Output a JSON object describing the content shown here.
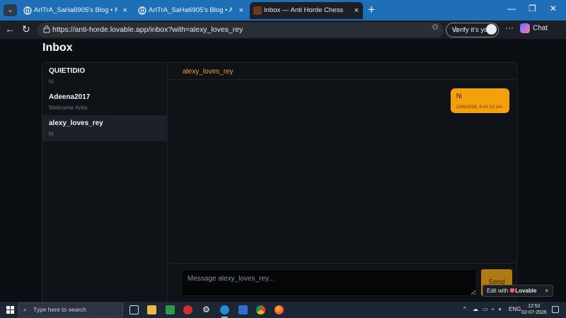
{
  "browser": {
    "tabs": [
      {
        "title": "ArITrA_SaHa6905's Blog • New po",
        "active": false
      },
      {
        "title": "ArITrA_SaHa6905's Blog • AntiHor",
        "active": false
      },
      {
        "title": "Inbox — Anti Horde Chess",
        "active": true
      }
    ],
    "address": {
      "url": "https://anti-horde.lovable.app/inbox?with=alexy_loves_rey"
    },
    "verify_label": "Verify it's you",
    "chat_label": "Chat"
  },
  "page": {
    "title": "Inbox",
    "conversations": [
      {
        "name": "QUIETIDIO",
        "preview": "hi",
        "active": false
      },
      {
        "name": "Adeena2017",
        "preview": "Welcome Arita",
        "active": false
      },
      {
        "name": "alexy_loves_rey",
        "preview": "hi",
        "active": true
      }
    ],
    "thread": {
      "partner": "alexy_loves_rey",
      "messages": [
        {
          "text": "hi",
          "time": "23/6/2026, 8:41:12 am",
          "from_me": true
        }
      ]
    },
    "composer": {
      "placeholder": "Message alexy_loves_rey...",
      "send_label": "Send"
    },
    "lovable_badge": {
      "prefix": "Edit with",
      "brand": "Lovable",
      "close": "×"
    }
  },
  "taskbar": {
    "search_placeholder": "Type here to search",
    "language": "ENG",
    "time": "12:52",
    "date": "02-07-2026"
  },
  "colors": {
    "accent": "#f59f0a",
    "tabbar": "#1f6fb8",
    "page_bg": "#0b0e13"
  }
}
